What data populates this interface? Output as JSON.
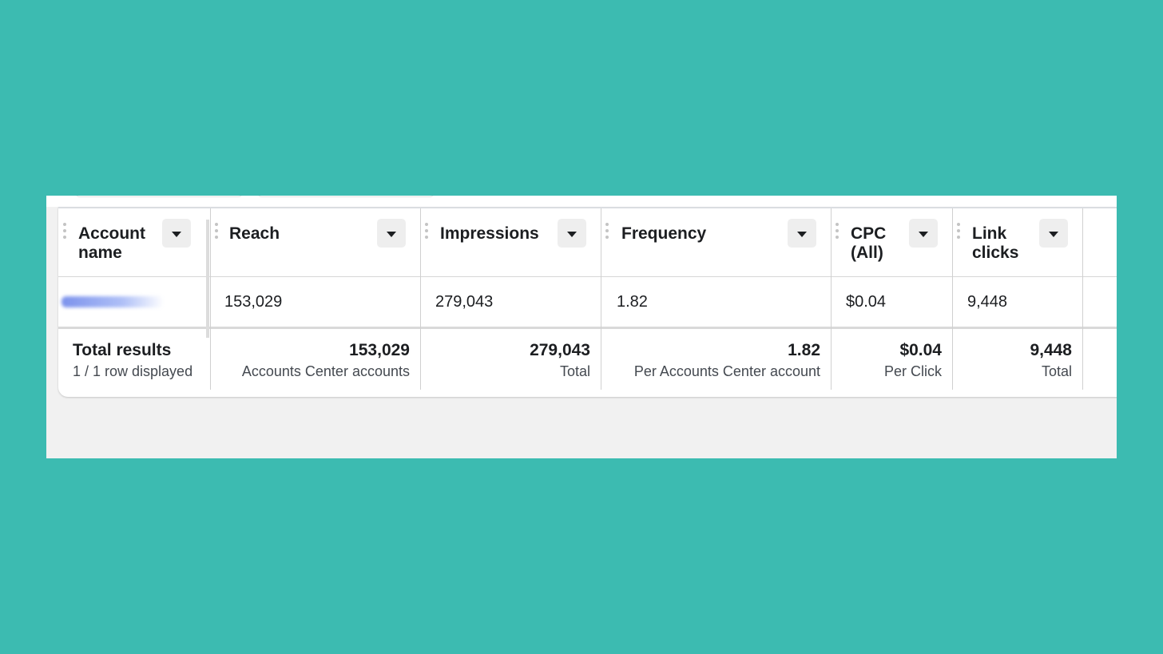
{
  "table": {
    "columns": [
      {
        "id": "account_name",
        "header": "Account name",
        "header_lines": [
          "Account",
          "name"
        ],
        "value": "",
        "total": "Total results",
        "total_sub": "1 / 1 row displayed"
      },
      {
        "id": "reach",
        "header": "Reach",
        "header_lines": [
          "Reach"
        ],
        "value": "153,029",
        "total": "153,029",
        "total_sub": "Accounts Center accounts"
      },
      {
        "id": "impressions",
        "header": "Impressions",
        "header_lines": [
          "Impressions"
        ],
        "value": "279,043",
        "total": "279,043",
        "total_sub": "Total"
      },
      {
        "id": "frequency",
        "header": "Frequency",
        "header_lines": [
          "Frequency"
        ],
        "value": "1.82",
        "total": "1.82",
        "total_sub": "Per Accounts Center account"
      },
      {
        "id": "cpc_all",
        "header": "CPC (All)",
        "header_lines": [
          "CPC",
          "(All)"
        ],
        "value": "$0.04",
        "total": "$0.04",
        "total_sub": "Per Click"
      },
      {
        "id": "link_clicks",
        "header": "Link clicks",
        "header_lines": [
          "Link",
          "clicks"
        ],
        "value": "9,448",
        "total": "9,448",
        "total_sub": "Total"
      }
    ]
  },
  "icons": {
    "sort": "caret-down-icon",
    "drag": "drag-handle-icon"
  },
  "colors": {
    "background": "#3cbbb1",
    "card": "#ffffff",
    "panel": "#f1f1f1",
    "text": "#1c1e21",
    "muted": "#444950"
  }
}
